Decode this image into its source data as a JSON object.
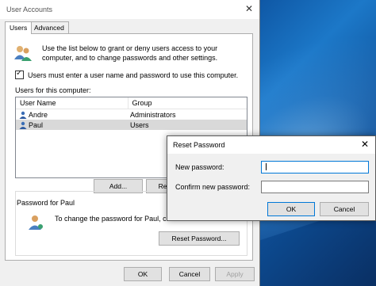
{
  "window": {
    "title": "User Accounts",
    "close_glyph": "✕"
  },
  "tabs": [
    {
      "label": "Users",
      "active": true
    },
    {
      "label": "Advanced",
      "active": false
    }
  ],
  "users_tab": {
    "intro_text": "Use the list below to grant or deny users access to your computer, and to change passwords and other settings.",
    "checkbox_label": "Users must enter a user name and password to use this computer.",
    "checkbox_checked": true,
    "list_label": "Users for this computer:",
    "columns": [
      "User Name",
      "Group"
    ],
    "rows": [
      {
        "user": "Andre",
        "group": "Administrators",
        "selected": false
      },
      {
        "user": "Paul",
        "group": "Users",
        "selected": true
      }
    ],
    "add_label": "Add...",
    "remove_label": "Re",
    "password_group_title": "Password for Paul",
    "password_text": "To change the password for Paul, click Re",
    "reset_button_label": "Reset Password..."
  },
  "footer": {
    "ok": "OK",
    "cancel": "Cancel",
    "apply": "Apply"
  },
  "reset_dialog": {
    "title": "Reset Password",
    "close_glyph": "✕",
    "new_password_label": "New password:",
    "confirm_password_label": "Confirm new password:",
    "new_password_value": "",
    "confirm_password_value": "",
    "ok": "OK",
    "cancel": "Cancel"
  }
}
